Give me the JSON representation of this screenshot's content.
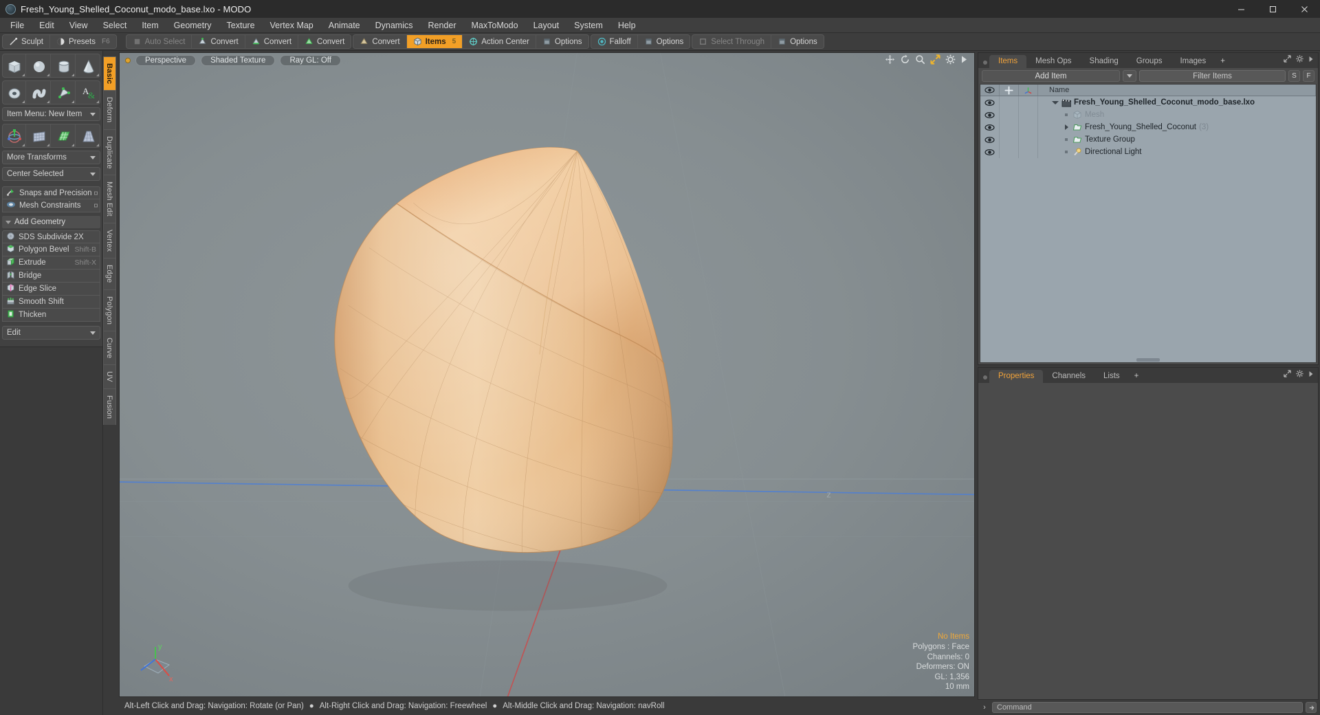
{
  "window": {
    "title": "Fresh_Young_Shelled_Coconut_modo_base.lxo - MODO",
    "logo_icon": "modo-logo-icon",
    "minimize_label": "Minimize",
    "maximize_label": "Maximize",
    "close_label": "Close"
  },
  "menubar": {
    "items": [
      {
        "label": "File"
      },
      {
        "label": "Edit"
      },
      {
        "label": "View"
      },
      {
        "label": "Select"
      },
      {
        "label": "Item"
      },
      {
        "label": "Geometry"
      },
      {
        "label": "Texture"
      },
      {
        "label": "Vertex Map"
      },
      {
        "label": "Animate"
      },
      {
        "label": "Dynamics"
      },
      {
        "label": "Render"
      },
      {
        "label": "MaxToModo"
      },
      {
        "label": "Layout"
      },
      {
        "label": "System"
      },
      {
        "label": "Help"
      }
    ]
  },
  "modebar": {
    "groups": [
      {
        "buttons": [
          {
            "label": "Sculpt",
            "icon": "sculpt-brush-icon",
            "state": "normal",
            "shortcut": ""
          },
          {
            "label": "Presets",
            "icon": "presets-sphere-icon",
            "state": "normal",
            "shortcut": "F6"
          }
        ]
      },
      {
        "buttons": [
          {
            "label": "Auto Select",
            "icon": "auto-select-icon",
            "state": "dim",
            "shortcut": ""
          },
          {
            "label": "Convert",
            "icon": "convert-vertex-icon",
            "state": "normal",
            "shortcut": ""
          },
          {
            "label": "Convert",
            "icon": "convert-edge-icon",
            "state": "normal",
            "shortcut": ""
          },
          {
            "label": "Convert",
            "icon": "convert-polygon-icon",
            "state": "normal",
            "shortcut": ""
          }
        ]
      },
      {
        "buttons": [
          {
            "label": "Convert",
            "icon": "convert-material-icon",
            "state": "normal",
            "shortcut": ""
          },
          {
            "label": "Items",
            "icon": "items-cube-icon",
            "state": "active",
            "shortcut": "5"
          },
          {
            "label": "Action Center",
            "icon": "action-center-icon",
            "state": "normal",
            "shortcut": ""
          },
          {
            "label": "Options",
            "icon": "options-panel-icon",
            "state": "normal",
            "shortcut": ""
          }
        ]
      },
      {
        "buttons": [
          {
            "label": "Falloff",
            "icon": "falloff-target-icon",
            "state": "normal",
            "shortcut": ""
          },
          {
            "label": "Options",
            "icon": "options-panel-icon",
            "state": "normal",
            "shortcut": ""
          }
        ]
      },
      {
        "buttons": [
          {
            "label": "Select Through",
            "icon": "select-through-icon",
            "state": "dim",
            "shortcut": ""
          },
          {
            "label": "Options",
            "icon": "options-panel-icon",
            "state": "normal",
            "shortcut": ""
          }
        ]
      }
    ]
  },
  "left_panel": {
    "primitive_row_1": [
      {
        "icon": "cube-primitive-icon",
        "name": "cube"
      },
      {
        "icon": "sphere-primitive-icon",
        "name": "sphere"
      },
      {
        "icon": "cylinder-primitive-icon",
        "name": "cylinder"
      },
      {
        "icon": "cone-primitive-icon",
        "name": "cone"
      }
    ],
    "primitive_row_2": [
      {
        "icon": "torus-primitive-icon",
        "name": "torus"
      },
      {
        "icon": "tube-primitive-icon",
        "name": "tube"
      },
      {
        "icon": "polygon-pen-icon",
        "name": "pen"
      },
      {
        "icon": "text-tool-icon",
        "name": "text"
      }
    ],
    "item_menu": {
      "label": "Item Menu: New Item"
    },
    "transform_row": [
      {
        "icon": "transform-gizmo-icon",
        "name": "transform"
      },
      {
        "icon": "bend-grid-icon",
        "name": "bend"
      },
      {
        "icon": "shear-grid-icon",
        "name": "shear"
      },
      {
        "icon": "taper-grid-icon",
        "name": "taper"
      }
    ],
    "more_transforms": {
      "label": "More Transforms"
    },
    "center_selected": {
      "label": "Center Selected"
    },
    "snaps": {
      "label": "Snaps and Precision",
      "icon": "snap-magnet-icon"
    },
    "mesh_constraints": {
      "label": "Mesh Constraints",
      "icon": "mesh-constraints-icon"
    },
    "add_geometry_header": {
      "label": "Add Geometry"
    },
    "geometry_tools": [
      {
        "label": "SDS Subdivide 2X",
        "shortcut": "",
        "icon": "sds-subdivide-icon"
      },
      {
        "label": "Polygon Bevel",
        "shortcut": "Shift-B",
        "icon": "polygon-bevel-icon"
      },
      {
        "label": "Extrude",
        "shortcut": "Shift-X",
        "icon": "extrude-icon"
      },
      {
        "label": "Bridge",
        "shortcut": "",
        "icon": "bridge-icon"
      },
      {
        "label": "Edge Slice",
        "shortcut": "",
        "icon": "edge-slice-icon"
      },
      {
        "label": "Smooth Shift",
        "shortcut": "",
        "icon": "smooth-shift-icon"
      },
      {
        "label": "Thicken",
        "shortcut": "",
        "icon": "thicken-icon"
      }
    ],
    "edit_dropdown": {
      "label": "Edit"
    }
  },
  "vertical_tabs": [
    {
      "label": "Basic",
      "active": true
    },
    {
      "label": "Deform",
      "active": false
    },
    {
      "label": "Duplicate",
      "active": false
    },
    {
      "label": "Mesh Edit",
      "active": false
    },
    {
      "label": "Vertex",
      "active": false
    },
    {
      "label": "Edge",
      "active": false
    },
    {
      "label": "Polygon",
      "active": false
    },
    {
      "label": "Curve",
      "active": false
    },
    {
      "label": "UV",
      "active": false
    },
    {
      "label": "Fusion",
      "active": false
    }
  ],
  "viewport": {
    "view_mode": "Perspective",
    "shading_mode": "Shaded Texture",
    "raygl": "Ray GL: Off",
    "tools": [
      {
        "icon": "pan-move-icon"
      },
      {
        "icon": "rotate-icon"
      },
      {
        "icon": "zoom-magnifier-icon"
      },
      {
        "icon": "fit-expand-icon"
      },
      {
        "icon": "gear-icon"
      },
      {
        "icon": "play-arrow-icon"
      }
    ],
    "stats": {
      "selection": "No Items",
      "polygons": "Polygons : Face",
      "channels": "Channels: 0",
      "deformers": "Deformers: ON",
      "gl": "GL: 1,356",
      "grid": "10 mm"
    },
    "gizmo": {
      "y_label": "y",
      "x_label": "x",
      "z_label": "z"
    },
    "model_name": "coconut-mesh"
  },
  "statusbar": {
    "hint_1": "Alt-Left Click and Drag: Navigation: Rotate (or Pan)",
    "hint_2": "Alt-Right Click and Drag: Navigation: Freewheel",
    "hint_3": "Alt-Middle Click and Drag: Navigation: navRoll"
  },
  "right_panel": {
    "tabs": [
      {
        "label": "Items",
        "active": true
      },
      {
        "label": "Mesh Ops",
        "active": false
      },
      {
        "label": "Shading",
        "active": false
      },
      {
        "label": "Groups",
        "active": false
      },
      {
        "label": "Images",
        "active": false
      },
      {
        "label": "+",
        "active": false
      }
    ],
    "add_item_label": "Add Item",
    "filter_placeholder": "Filter Items",
    "filter_s_label": "S",
    "filter_f_label": "F",
    "columns": [
      {
        "label": "",
        "icon": "eye-visibility-icon"
      },
      {
        "label": "",
        "icon": "lock-crosshair-icon"
      },
      {
        "label": "",
        "icon": "axis-gizmo-icon"
      },
      {
        "label": "Name",
        "icon": ""
      }
    ],
    "rows": [
      {
        "name": "Fresh_Young_Shelled_Coconut_modo_base.lxo",
        "count": "",
        "level": 0,
        "icon": "scene-clapboard-icon",
        "twirl": "open",
        "muted": false
      },
      {
        "name": "Mesh",
        "count": "",
        "level": 1,
        "icon": "mesh-cube-icon",
        "twirl": "none",
        "muted": true
      },
      {
        "name": "Fresh_Young_Shelled_Coconut",
        "count": "(3)",
        "level": 1,
        "icon": "group-folder-icon",
        "twirl": "closed",
        "muted": false
      },
      {
        "name": "Texture Group",
        "count": "",
        "level": 1,
        "icon": "group-folder-icon",
        "twirl": "none",
        "muted": false
      },
      {
        "name": "Directional Light",
        "count": "",
        "level": 1,
        "icon": "light-icon",
        "twirl": "none",
        "muted": false
      }
    ]
  },
  "properties_panel": {
    "tabs": [
      {
        "label": "Properties",
        "active": true
      },
      {
        "label": "Channels",
        "active": false
      },
      {
        "label": "Lists",
        "active": false
      },
      {
        "label": "+",
        "active": false
      }
    ]
  },
  "command_bar": {
    "placeholder": "Command",
    "arrow_icon": "chevron-right-icon",
    "submit_icon": "command-submit-icon"
  },
  "colors": {
    "accent": "#f29f26",
    "panel_bg": "#434343",
    "tree_bg": "#9aa5ad",
    "coconut": "#e6b77e"
  }
}
